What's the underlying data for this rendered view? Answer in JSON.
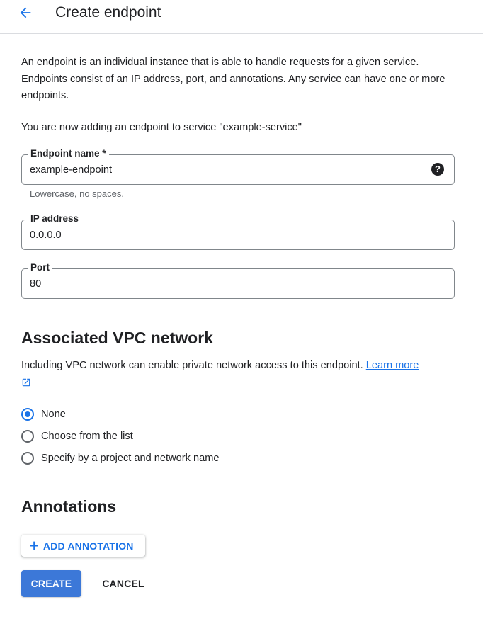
{
  "header": {
    "title": "Create endpoint",
    "back_icon": "arrow-back-icon"
  },
  "intro": {
    "description": "An endpoint is an individual instance that is able to handle requests for a given service. Endpoints consist of an IP address, port, and annotations. Any service can have one or more endpoints.",
    "adding_text": "You are now adding an endpoint to service \"example-service\""
  },
  "fields": {
    "endpoint_name": {
      "label": "Endpoint name *",
      "value": "example-endpoint",
      "hint": "Lowercase, no spaces.",
      "help_icon": "?"
    },
    "ip_address": {
      "label": "IP address",
      "value": "0.0.0.0"
    },
    "port": {
      "label": "Port",
      "value": "80"
    }
  },
  "vpc": {
    "title": "Associated VPC network",
    "description": "Including VPC network can enable private network access to this endpoint.",
    "learn_more": "Learn more",
    "options": [
      {
        "label": "None",
        "checked": true
      },
      {
        "label": "Choose from the list",
        "checked": false
      },
      {
        "label": "Specify by a project and network name",
        "checked": false
      }
    ]
  },
  "annotations": {
    "title": "Annotations",
    "add_label": "ADD ANNOTATION"
  },
  "actions": {
    "create_label": "CREATE",
    "cancel_label": "CANCEL"
  },
  "colors": {
    "accent": "#1a73e8",
    "primary_button": "#3c78d8",
    "border": "#80868b"
  }
}
